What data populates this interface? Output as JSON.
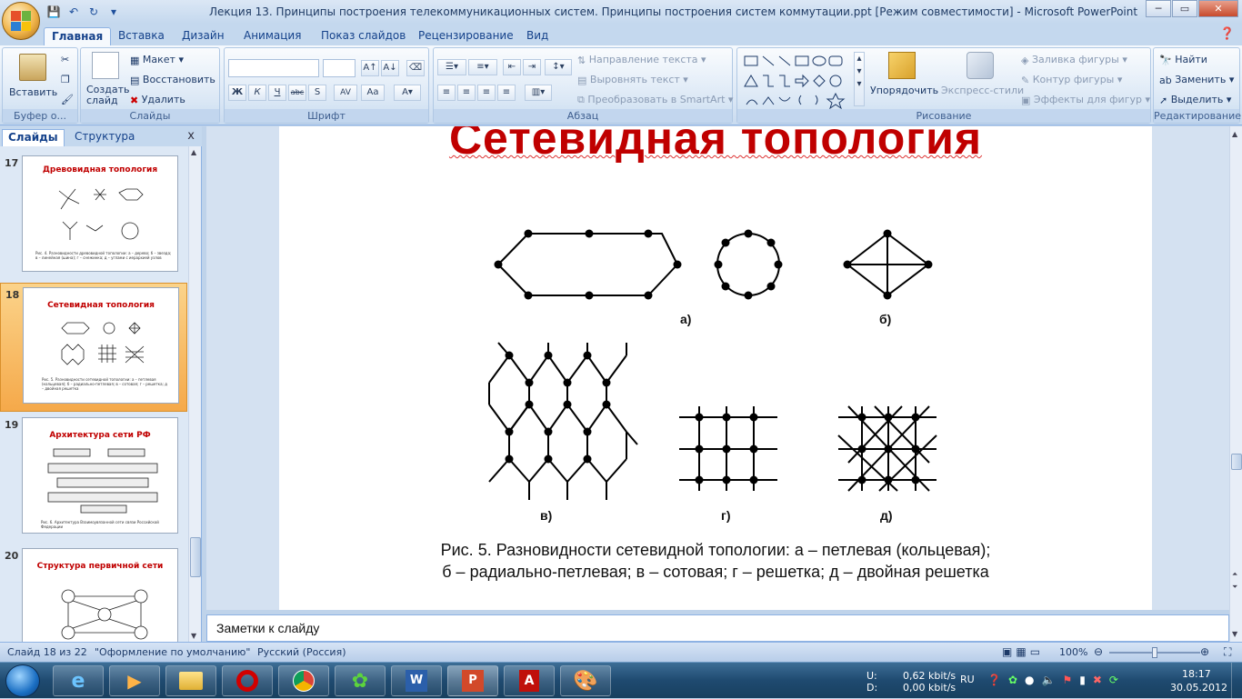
{
  "window": {
    "title": "Лекция 13. Принципы построения телекоммуникационных  систем. Принципы построения систем коммутации.ppt [Режим совместимости] - Microsoft PowerPoint",
    "min": "─",
    "max": "▭",
    "close": "✕"
  },
  "tabs": [
    "Главная",
    "Вставка",
    "Дизайн",
    "Анимация",
    "Показ слайдов",
    "Рецензирование",
    "Вид"
  ],
  "ribbon": {
    "clipboard": {
      "paste": "Вставить",
      "label": "Буфер о..."
    },
    "slides": {
      "new_slide": "Создать\nслайд",
      "layout": "Макет",
      "reset": "Восстановить",
      "delete": "Удалить",
      "label": "Слайды"
    },
    "font": {
      "label": "Шрифт",
      "bold": "Ж",
      "italic": "К",
      "underline": "Ч",
      "strike": "abc",
      "spacing": "AV",
      "case": "Aa"
    },
    "paragraph": {
      "text_direction": "Направление текста",
      "align_text": "Выровнять текст",
      "smartart": "Преобразовать в SmartArt",
      "label": "Абзац"
    },
    "drawing": {
      "arrange": "Упорядочить",
      "quick_styles": "Экспресс-стили",
      "fill": "Заливка фигуры",
      "outline": "Контур фигуры",
      "effects": "Эффекты для фигур",
      "label": "Рисование"
    },
    "editing": {
      "find": "Найти",
      "replace": "Заменить",
      "select": "Выделить",
      "label": "Редактирование"
    }
  },
  "left_pane": {
    "tab_slides": "Слайды",
    "tab_outline": "Структура",
    "close": "x",
    "slides": [
      {
        "num": "17",
        "title": "Древовидная  топология",
        "caption": "Рис. 4. Разновидности древовидной топологии: а – дерево; б – звезда; в – линейная (шина); г – снежинка; д – углами с иерархией узлов"
      },
      {
        "num": "18",
        "title": "Сетевидная топология",
        "caption": "Рис. 5. Разновидности сетевидной топологии: а – петлевая (кольцевая); б – радиально-петлевая; в – сотовая; г – решетка; д – двойная решетка"
      },
      {
        "num": "19",
        "title": "Архитектура  сети РФ",
        "caption": "Рис. 6. Архитектура Взаимоувязанной сети связи Российской Федерации"
      },
      {
        "num": "20",
        "title": "Структура  первичной  сети",
        "caption": ""
      }
    ]
  },
  "slide": {
    "title": "Сетевидная топология",
    "labels": {
      "a": "а)",
      "b": "б)",
      "v": "в)",
      "g": "г)",
      "d": "д)"
    },
    "caption_line1": "Рис. 5. Разновидности сетевидной топологии: а – петлевая (кольцевая);",
    "caption_line2": "б – радиально-петлевая; в – сотовая; г – решетка; д – двойная решетка"
  },
  "notes": {
    "placeholder": "Заметки к слайду"
  },
  "status": {
    "slide_of": "Слайд 18 из 22",
    "theme": "\"Оформление по умолчанию\"",
    "language": "Русский (Россия)",
    "zoom": "100%",
    "zoom_level": 0.5
  },
  "taskbar": {
    "net_u_label": "U:",
    "net_d_label": "D:",
    "net_u": "0,62 kbit/s",
    "net_d": "0,00 kbit/s",
    "lang": "RU",
    "time": "18:17",
    "date": "30.05.2012"
  },
  "colors": {
    "title_red": "#c00000",
    "ribbon_blue": "#15428b",
    "selected_slide": "#f5a94a"
  }
}
